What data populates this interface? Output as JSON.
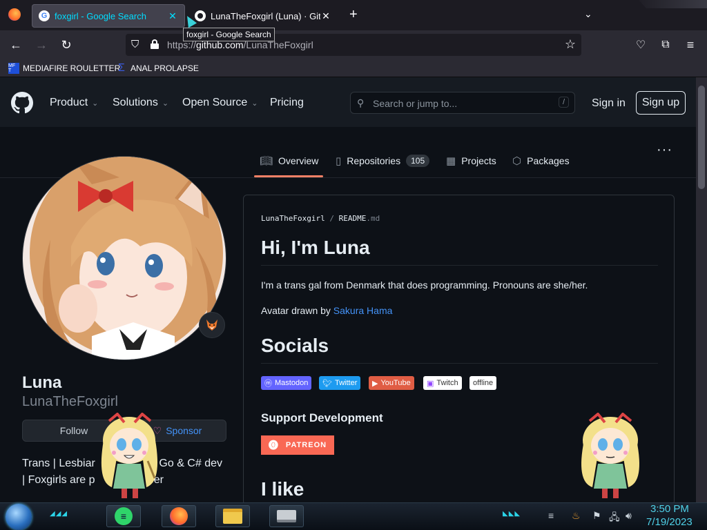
{
  "browser": {
    "tabs": [
      {
        "title": "foxgirl - Google Search",
        "active": true
      },
      {
        "title": "LunaTheFoxgirl (Luna) · GitHub",
        "active": false
      }
    ],
    "tooltip": "foxgirl - Google Search",
    "url_prefix": "https://",
    "url_domain": "github.com",
    "url_path": "/LunaTheFoxgirl",
    "bookmarks": [
      {
        "label": "MEDIAFIRE ROULETTER",
        "icon_text": "MF T"
      },
      {
        "label": "ANAL PROLAPSE",
        "icon": "sigma-icon"
      }
    ]
  },
  "github": {
    "nav": {
      "product": "Product",
      "solutions": "Solutions",
      "open_source": "Open Source",
      "pricing": "Pricing",
      "search_placeholder": "Search or jump to...",
      "search_shortcut": "/",
      "sign_in": "Sign in",
      "sign_up": "Sign up"
    },
    "tabs": {
      "overview": "Overview",
      "repositories": "Repositories",
      "repositories_count": "105",
      "projects": "Projects",
      "packages": "Packages"
    },
    "profile": {
      "name": "Luna",
      "login": "LunaTheFoxgirl",
      "follow": "Follow",
      "sponsor": "Sponsor",
      "bio_line1": "Trans | Lesbiar",
      "bio_line1_end": "D, Go & C# dev",
      "bio_line2": "| Foxgirls are p",
      "bio_line2_end": "ber"
    },
    "readme": {
      "path_user": "LunaTheFoxgirl",
      "path_sep": "/",
      "path_file": "README",
      "path_ext": ".md",
      "h1": "Hi, I'm Luna",
      "intro": "I'm a trans gal from Denmark that does programming. Pronouns are she/her.",
      "avatar_prefix": "Avatar drawn by ",
      "avatar_artist": "Sakura Hama",
      "socials_heading": "Socials",
      "badges": [
        {
          "label": "Mastodon",
          "color": "#595aff"
        },
        {
          "label": "Twitter",
          "color": "#1d9bf0"
        },
        {
          "label": "YouTube",
          "color": "#e05d44"
        },
        {
          "label": "Twitch",
          "color": "#ffffff"
        },
        {
          "label": "offline",
          "color": "#ffffff"
        }
      ],
      "support_heading": "Support Development",
      "patreon": "PATREON",
      "like_heading": "I like"
    }
  },
  "taskbar": {
    "time": "3:50 PM",
    "date": "7/19/2023"
  },
  "colors": {
    "accent_tab": "#00ddff",
    "link": "#4493f8",
    "tab_underline": "#f78166",
    "patreon": "#f96854"
  }
}
